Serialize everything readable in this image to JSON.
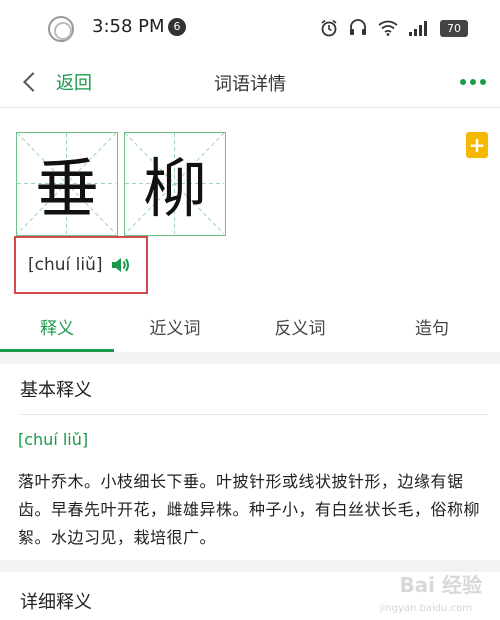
{
  "status_bar": {
    "time": "3:58 PM",
    "notification_count": "6",
    "battery": "70",
    "icons": [
      "alarm-icon",
      "headset-icon",
      "wifi-icon",
      "signal-icon",
      "battery-icon"
    ]
  },
  "nav": {
    "back_label": "返回",
    "title": "词语详情"
  },
  "word": {
    "chars": [
      "垂",
      "柳"
    ],
    "pinyin": "[chuí liǔ]",
    "add_button_label": "+"
  },
  "tabs": [
    {
      "label": "释义",
      "active": true
    },
    {
      "label": "近义词",
      "active": false
    },
    {
      "label": "反义词",
      "active": false
    },
    {
      "label": "造句",
      "active": false
    }
  ],
  "basic_definition": {
    "title": "基本释义",
    "pinyin": "[chuí liǔ]",
    "text": "落叶乔木。小枝细长下垂。叶披针形或线状披针形，边缘有锯齿。早春先叶开花，雌雄异株。种子小，有白丝状长毛，俗称柳絮。水边习见，栽培很广。"
  },
  "detail_definition": {
    "title": "详细释义"
  },
  "watermark": {
    "text": "Bai 经验",
    "sub": "jingyan.baidu.com"
  },
  "colors": {
    "accent": "#1a9a49",
    "highlight_border": "#d44a4a",
    "add_button": "#f5b700"
  }
}
